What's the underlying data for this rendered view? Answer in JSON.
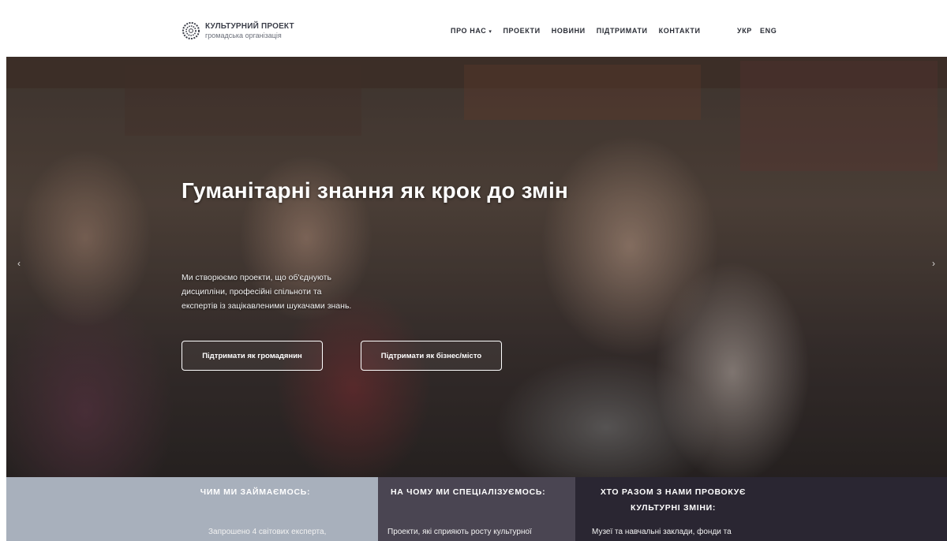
{
  "header": {
    "logo": {
      "title": "КУЛЬТУРНИЙ ПРОЕКТ",
      "subtitle": "громадська організація"
    },
    "nav": [
      {
        "label": "ПРО НАС",
        "dropdown": true
      },
      {
        "label": "ПРОЕКТИ"
      },
      {
        "label": "НОВИНИ"
      },
      {
        "label": "ПІДТРИМАТИ"
      },
      {
        "label": "КОНТАКТИ"
      }
    ],
    "nav_caret": "▾",
    "languages": [
      "УКР",
      "ENG"
    ]
  },
  "hero": {
    "title": "Гуманітарні знання як крок до змін",
    "text": "Ми створюємо проекти, що об'єднують дисципліни, професійні спільноти та експертів із зацікавленими шукачами знань.",
    "buttons": [
      {
        "label": "Підтримати як громадянин"
      },
      {
        "label": "Підтримати як бізнес/місто"
      }
    ],
    "arrow_left": "‹",
    "arrow_right": "›"
  },
  "columns": [
    {
      "heading": "ЧИМ МИ ЗАЙМАЄМОСЬ:",
      "text": "Запрошено 4 світових експерта,",
      "color": "#a8b0bc"
    },
    {
      "heading": "НА ЧОМУ МИ СПЕЦІАЛІЗУЄМОСЬ:",
      "text": "Проекти, які сприяють росту культурної",
      "color": "#4a4552"
    },
    {
      "heading": "ХТО РАЗОМ З НАМИ ПРОВОКУЄ КУЛЬТУРНІ ЗМІНИ:",
      "text": "Музеї та навчальні заклади, фонди та",
      "color": "#2a2632"
    }
  ],
  "colors": {
    "nav_text": "#2a2d36",
    "button_border": "#ffffff"
  }
}
